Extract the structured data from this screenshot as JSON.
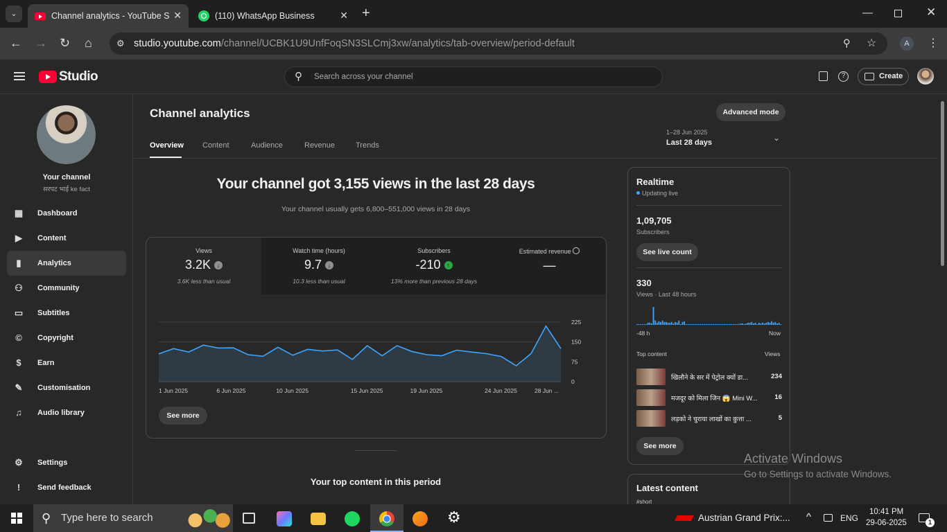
{
  "browser": {
    "tabs": [
      {
        "title": "Channel analytics - YouTube Studio"
      },
      {
        "title": "(110) WhatsApp Business"
      }
    ],
    "url_host": "studio.youtube.com",
    "url_path": "/channel/UCBK1U9UnfFoqSN3SLCmj3xw/analytics/tab-overview/period-default",
    "profile_initial": "A"
  },
  "header": {
    "logo_text": "Studio",
    "search_placeholder": "Search across your channel",
    "create_label": "Create"
  },
  "sidebar": {
    "channel_label": "Your channel",
    "channel_name": "सरपट भाई ke fact",
    "items": [
      {
        "label": "Dashboard",
        "icon": "dashboard-icon"
      },
      {
        "label": "Content",
        "icon": "content-icon"
      },
      {
        "label": "Analytics",
        "icon": "analytics-icon",
        "active": true
      },
      {
        "label": "Community",
        "icon": "community-icon"
      },
      {
        "label": "Subtitles",
        "icon": "subtitles-icon"
      },
      {
        "label": "Copyright",
        "icon": "copyright-icon"
      },
      {
        "label": "Earn",
        "icon": "earn-icon"
      },
      {
        "label": "Customisation",
        "icon": "customisation-icon"
      },
      {
        "label": "Audio library",
        "icon": "audio-library-icon"
      }
    ],
    "settings_label": "Settings",
    "feedback_label": "Send feedback"
  },
  "analytics": {
    "title": "Channel analytics",
    "advanced_mode": "Advanced mode",
    "tabs": [
      "Overview",
      "Content",
      "Audience",
      "Revenue",
      "Trends"
    ],
    "period_range": "1–28 Jun 2025",
    "period_label": "Last 28 days",
    "headline": "Your channel got 3,155 views in the last 28 days",
    "subheadline": "Your channel usually gets 6,800–551,000 views in 28 days",
    "stats": [
      {
        "label": "Views",
        "value": "3.2K",
        "trend": "down",
        "note": "3.6K less than usual"
      },
      {
        "label": "Watch time (hours)",
        "value": "9.7",
        "trend": "down",
        "note": "10.3 less than usual"
      },
      {
        "label": "Subscribers",
        "value": "-210",
        "trend": "up",
        "note": "13% more than previous 28 days"
      },
      {
        "label": "Estimated revenue",
        "value": "—",
        "note": ""
      }
    ],
    "see_more": "See more",
    "top_content_heading": "Your top content in this period"
  },
  "chart_data": {
    "type": "area",
    "x": [
      "1 Jun 2025",
      "2 Jun",
      "3 Jun",
      "4 Jun",
      "5 Jun",
      "6 Jun 2025",
      "7 Jun",
      "8 Jun",
      "9 Jun",
      "10 Jun 2025",
      "11 Jun",
      "12 Jun",
      "13 Jun",
      "14 Jun",
      "15 Jun 2025",
      "16 Jun",
      "17 Jun",
      "18 Jun",
      "19 Jun 2025",
      "20 Jun",
      "21 Jun",
      "22 Jun",
      "23 Jun",
      "24 Jun 2025",
      "25 Jun",
      "26 Jun",
      "27 Jun",
      "28 Jun ..."
    ],
    "x_tick_labels": [
      "1 Jun 2025",
      "6 Jun 2025",
      "10 Jun 2025",
      "15 Jun 2025",
      "19 Jun 2025",
      "24 Jun 2025",
      "28 Jun ..."
    ],
    "values": [
      105,
      125,
      112,
      138,
      127,
      128,
      102,
      96,
      130,
      100,
      122,
      116,
      120,
      84,
      136,
      98,
      136,
      114,
      102,
      98,
      119,
      112,
      106,
      95,
      60,
      106,
      210,
      125
    ],
    "yticks": [
      0,
      75,
      150,
      225
    ],
    "ylim": [
      0,
      225
    ],
    "color": "#3ea6ff"
  },
  "realtime": {
    "title": "Realtime",
    "status": "Updating live",
    "subscribers_value": "1,09,705",
    "subscribers_label": "Subscribers",
    "live_count_btn": "See live count",
    "views_value": "330",
    "views_label": "Views · Last 48 hours",
    "chart_left": "-48 h",
    "chart_right": "Now",
    "bars": [
      1,
      1,
      1,
      1,
      1,
      1,
      3,
      3,
      2,
      25,
      6,
      3,
      5,
      4,
      6,
      4,
      4,
      3,
      3,
      4,
      2,
      4,
      3,
      6,
      1,
      4,
      5,
      1,
      1,
      1,
      1,
      1,
      1,
      1,
      1,
      1,
      1,
      1,
      1,
      1,
      1,
      1,
      1,
      1,
      1,
      1,
      1,
      1,
      1,
      1,
      1,
      1,
      1,
      1,
      1,
      1,
      1,
      2,
      2,
      1,
      2,
      3,
      3,
      4,
      2,
      3,
      1,
      3,
      2,
      3,
      2,
      3,
      4,
      3,
      5,
      3,
      4,
      2,
      3,
      1
    ],
    "top_content_label": "Top content",
    "views_col_label": "Views",
    "top_content": [
      {
        "title": "खिलौने के सर में पेट्रोल क्यों डा...",
        "views": "234"
      },
      {
        "title": "मजदूर को मिला जिन 😱 Mini W...",
        "views": "16"
      },
      {
        "title": "लड़को ने चुराया लाखों का कुत्ता ...",
        "views": "5"
      }
    ],
    "see_more": "See more",
    "latest_title": "Latest content",
    "latest_tag": "#short"
  },
  "watermark": {
    "line1": "Activate Windows",
    "line2": "Go to Settings to activate Windows."
  },
  "taskbar": {
    "search_placeholder": "Type here to search",
    "news": "Austrian Grand Prix:...",
    "lang": "ENG",
    "time": "10:41 PM",
    "date": "29-06-2025",
    "notif_count": "1"
  }
}
